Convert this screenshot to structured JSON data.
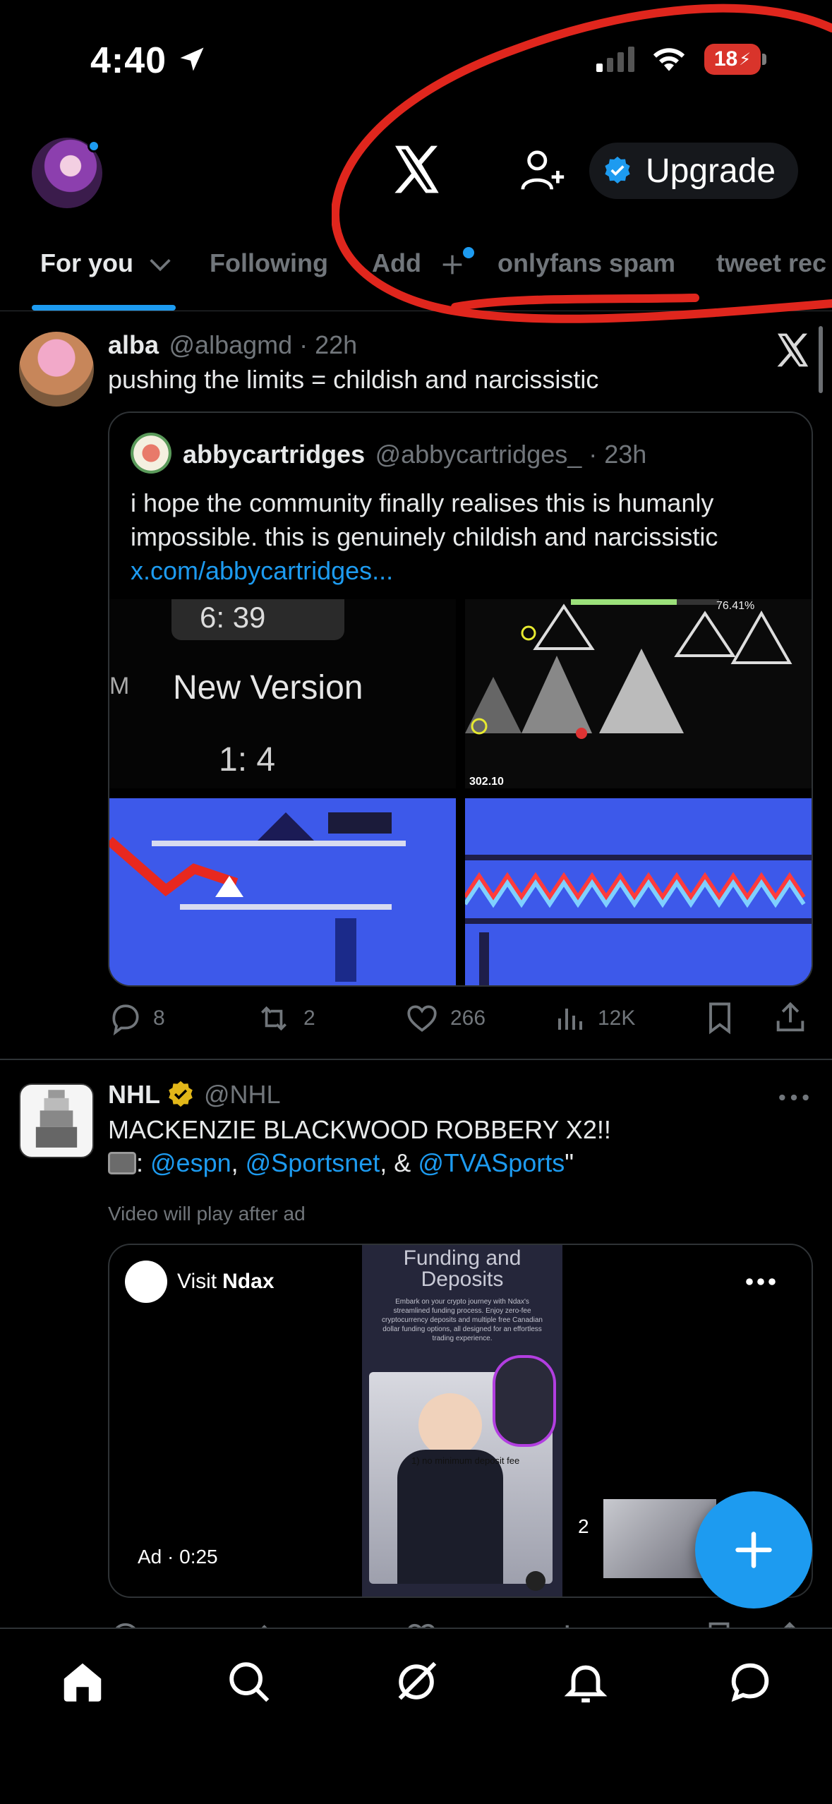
{
  "status_bar": {
    "time": "4:40",
    "battery": "18"
  },
  "header": {
    "upgrade_label": "Upgrade"
  },
  "tabs": [
    {
      "label": "For you"
    },
    {
      "label": "Following"
    },
    {
      "label": "Add"
    },
    {
      "label": "onlyfans spam"
    },
    {
      "label": "tweet rec"
    }
  ],
  "tweet1": {
    "name": "alba",
    "handle": "@albagmd · 22h",
    "text": "pushing the limits = childish and narcissistic",
    "quote": {
      "name": "abbycartridges",
      "handle": "@abbycartridges_ · 23h",
      "line1": "i hope the community finally realises this is humanly",
      "line2": "impossible. this is genuinely childish and narcissistic",
      "link": "x.com/abbycartridges...",
      "media1_time": "6: 39",
      "media1_title": "New Version",
      "media1_sub": "1: 4",
      "media1_edge": "M",
      "media2_score": "302.10",
      "media2_pct": "76.41%"
    },
    "stats": {
      "replies": "8",
      "retweets": "2",
      "likes": "266",
      "views": "12K"
    }
  },
  "tweet2": {
    "name": "NHL",
    "handle": "@NHL",
    "text": "MACKENZIE BLACKWOOD ROBBERY X2!!",
    "line2_prefix": ": ",
    "mention1": "@espn",
    "comma1": ", ",
    "mention2": "@Sportsnet",
    "amp": ", & ",
    "mention3": "@TVASports",
    "suffix": "\"",
    "video_note": "Video will play after ad",
    "ad": {
      "visit_prefix": "Visit",
      "visit_brand": "Ndax",
      "title_line1": "Funding and",
      "title_line2": "Deposits",
      "body": "Embark on your crypto journey with Ndax's streamlined funding process. Enjoy zero-fee cryptocurrency deposits and multiple free Canadian dollar funding options, all designed for an effortless trading experience.",
      "caption": "1) no minimum deposit fee",
      "timer": "Ad · 0:25",
      "counter": "2"
    }
  },
  "colors": {
    "accent": "#1d9bf0",
    "annotation": "#e0261d",
    "background": "#000000"
  }
}
